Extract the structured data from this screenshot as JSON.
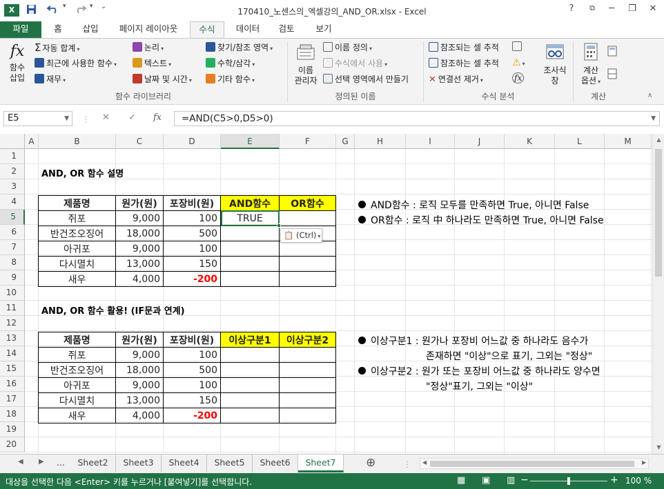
{
  "window": {
    "title": "170410_노센스의_엑셀강의_AND_OR.xlsx - Excel",
    "help": "?",
    "minimize": "─",
    "restore": "❐",
    "close": "✕"
  },
  "quick_access": {
    "save_icon": "save-icon",
    "undo_icon": "undo-icon",
    "redo_icon": "redo-icon"
  },
  "tabs": [
    "파일",
    "홈",
    "삽입",
    "페이지 레이아웃",
    "수식",
    "데이터",
    "검토",
    "보기"
  ],
  "active_tab": "수식",
  "ribbon": {
    "function_library": {
      "insert_function": "함수\n삽입",
      "insert_function_l1": "함수",
      "insert_function_l2": "삽입",
      "autosum": "자동 합계",
      "recently_used": "최근에 사용한 함수",
      "financial": "재무",
      "logical": "논리",
      "text": "텍스트",
      "date_time": "날짜 및 시간",
      "lookup": "찾기/참조 영역",
      "math": "수학/삼각",
      "more": "기타 함수",
      "label": "함수 라이브러리"
    },
    "defined_names": {
      "name_manager_l1": "이름",
      "name_manager_l2": "관리자",
      "define_name": "이름 정의",
      "use_in_formula": "수식에서 사용",
      "create_from_selection": "선택 영역에서 만들기",
      "label": "정의된 이름"
    },
    "formula_auditing": {
      "trace_precedents": "참조되는 셀 추적",
      "trace_dependents": "참조하는 셀 추적",
      "remove_arrows": "연결선 제거",
      "watch_l1": "조사식",
      "watch_l2": "창",
      "label": "수식 분석"
    },
    "calculation": {
      "options_l1": "계산",
      "options_l2": "옵션",
      "label": "계산"
    }
  },
  "formula_bar": {
    "name_box": "E5",
    "cancel": "✕",
    "enter": "✓",
    "fx": "fx",
    "formula": "=AND(C5>0,D5>0)"
  },
  "columns": [
    "A",
    "B",
    "C",
    "D",
    "E",
    "F",
    "G",
    "H",
    "I",
    "J",
    "K",
    "L",
    "M"
  ],
  "rows": [
    "1",
    "2",
    "3",
    "4",
    "5",
    "6",
    "7",
    "8",
    "9",
    "10",
    "11",
    "12",
    "13",
    "14",
    "15",
    "16",
    "17",
    "18",
    "19",
    "20"
  ],
  "selected_cell": "E5",
  "sheet": {
    "heading1": "AND, OR 함수 설명",
    "heading2": "AND, OR 함수 활용! (IF문과 연계)",
    "table1": {
      "headers": [
        "제품명",
        "원가(원)",
        "포장비(원)",
        "AND함수",
        "OR함수"
      ],
      "rows": [
        [
          "쥐포",
          "9,000",
          "100",
          "TRUE",
          ""
        ],
        [
          "반건조오징어",
          "18,000",
          "500",
          "",
          ""
        ],
        [
          "아귀포",
          "9,000",
          "100",
          "",
          ""
        ],
        [
          "다시멸치",
          "13,000",
          "150",
          "",
          ""
        ],
        [
          "새우",
          "4,000",
          "-200",
          "",
          ""
        ]
      ]
    },
    "table2": {
      "headers": [
        "제품명",
        "원가(원)",
        "포장비(원)",
        "이상구분1",
        "이상구분2"
      ],
      "rows": [
        [
          "쥐포",
          "9,000",
          "100",
          "",
          ""
        ],
        [
          "반건조오징어",
          "18,000",
          "500",
          "",
          ""
        ],
        [
          "아귀포",
          "9,000",
          "100",
          "",
          ""
        ],
        [
          "다시멸치",
          "13,000",
          "150",
          "",
          ""
        ],
        [
          "새우",
          "4,000",
          "-200",
          "",
          ""
        ]
      ]
    },
    "notes1": [
      "AND함수 : 로직 모두를 만족하면 True, 아니면 False",
      "OR함수 : 로직 中 하나라도 만족하면 True, 아니면 False"
    ],
    "notes2": {
      "n1_line1": "이상구분1 : 원가나 포장비 어느값 중 하나라도 음수가",
      "n1_line2": "존재하면 \"이상\"으로 표기, 그외는 \"정상\"",
      "n2_line1": "이상구분2 : 원가 또는 포장비 어느값 중 하나라도 양수면",
      "n2_line2": "\"정상\"표기, 그외는 \"이상\""
    },
    "paste_options": "(Ctrl)"
  },
  "sheet_tabs": {
    "ellipsis": "...",
    "tabs": [
      "Sheet2",
      "Sheet3",
      "Sheet4",
      "Sheet5",
      "Sheet6",
      "Sheet7"
    ],
    "active": "Sheet7",
    "add": "⊕"
  },
  "status": {
    "text": "대상을 선택한 다음 <Enter> 키를 누르거나 [붙여넣기]를 선택합니다.",
    "zoom": "100 %",
    "zoom_out": "−",
    "zoom_in": "+"
  },
  "colors": {
    "accent": "#217346",
    "header_yellow": "#ffff00",
    "negative": "#ff0000"
  }
}
